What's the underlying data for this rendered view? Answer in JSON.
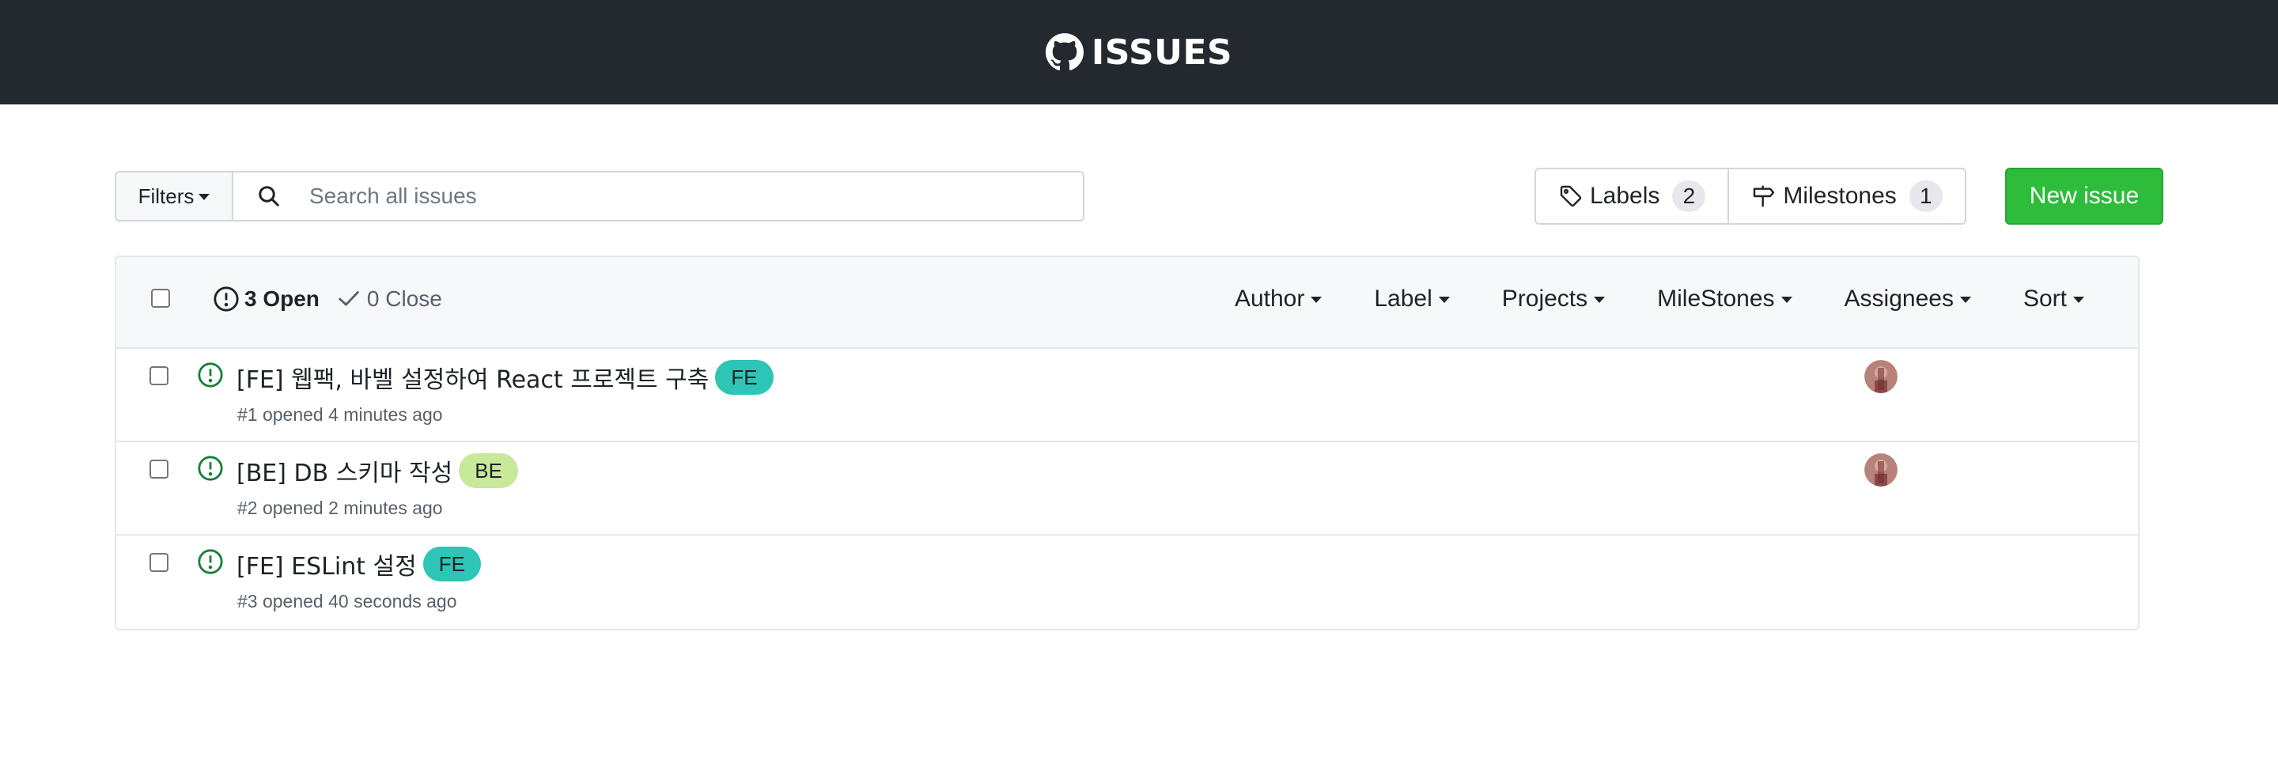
{
  "header": {
    "title": "ISSUES",
    "icon": "github-icon"
  },
  "toolbar": {
    "filters_label": "Filters",
    "search_placeholder": "Search all issues",
    "search_value": "",
    "labels_label": "Labels",
    "labels_count": "2",
    "milestones_label": "Milestones",
    "milestones_count": "1",
    "new_issue_label": "New issue",
    "new_issue_color": "#2ebc3b"
  },
  "list_header": {
    "open_label": "3 Open",
    "closed_label": "0 Close",
    "filters": [
      "Author",
      "Label",
      "Projects",
      "MileStones",
      "Assignees",
      "Sort"
    ]
  },
  "issues": [
    {
      "title": "[FE] 웹팩, 바벨 설정하여 React 프로젝트 구축",
      "label": "FE",
      "label_color": "#2ec4b6",
      "meta": "#1 opened 4 minutes ago",
      "has_assignee": true
    },
    {
      "title": "[BE] DB 스키마 작성",
      "label": "BE",
      "label_color": "#c8e89a",
      "meta": "#2 opened 2 minutes ago",
      "has_assignee": true
    },
    {
      "title": "[FE] ESLint 설정",
      "label": "FE",
      "label_color": "#2ec4b6",
      "meta": "#3 opened 40 seconds ago",
      "has_assignee": false
    }
  ],
  "colors": {
    "header_bg": "#24292f",
    "open_icon": "#1a7f37"
  }
}
